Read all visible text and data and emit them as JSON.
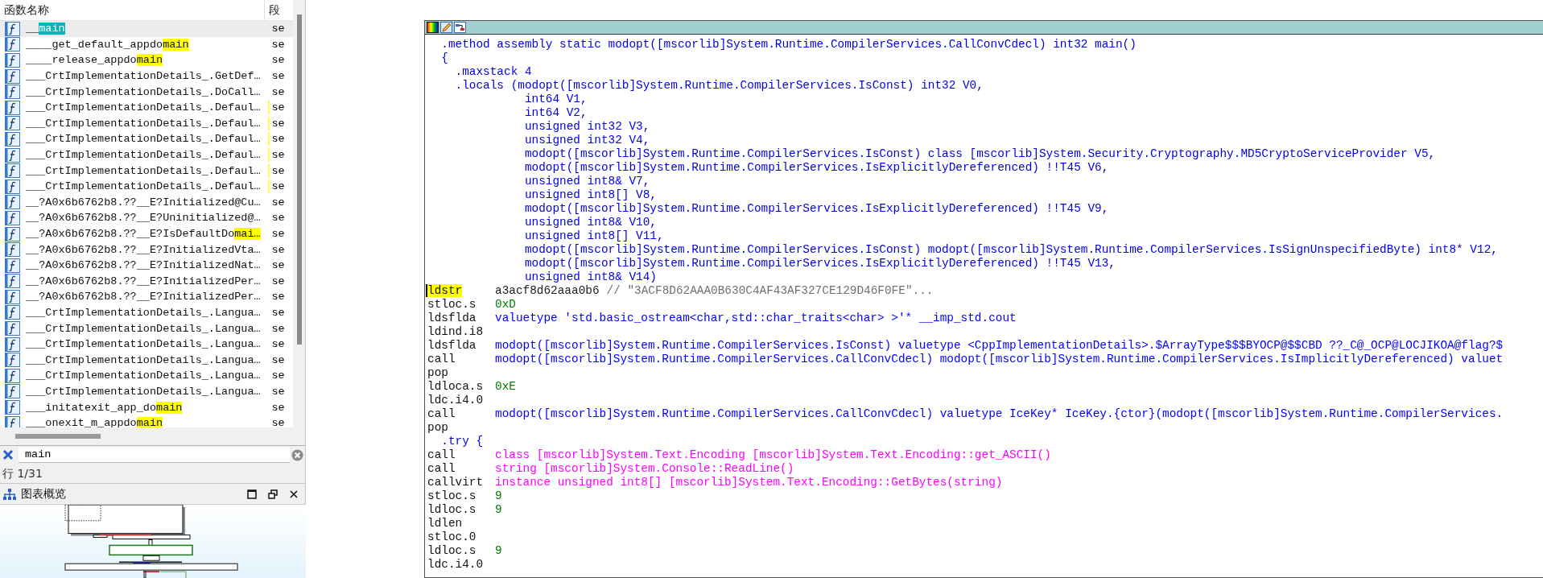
{
  "function_list": {
    "columns": [
      "函数名称",
      "段"
    ],
    "rows": [
      {
        "parts": [
          {
            "text": "__",
            "highlighted": false
          },
          {
            "text": "main",
            "highlighted": true
          }
        ],
        "segment": "se",
        "selected": true,
        "marked": false
      },
      {
        "parts": [
          {
            "text": "____get_default_appdo",
            "highlighted": false
          },
          {
            "text": "main",
            "highlighted": true
          }
        ],
        "segment": "se",
        "selected": false,
        "marked": false
      },
      {
        "parts": [
          {
            "text": "____release_appdo",
            "highlighted": false
          },
          {
            "text": "main",
            "highlighted": true
          }
        ],
        "segment": "se",
        "selected": false,
        "marked": false
      },
      {
        "parts": [
          {
            "text": "___CrtImplementationDetails_.GetDef…",
            "highlighted": false
          }
        ],
        "segment": "se",
        "selected": false,
        "marked": false
      },
      {
        "parts": [
          {
            "text": "___CrtImplementationDetails_.DoCall…",
            "highlighted": false
          }
        ],
        "segment": "se",
        "selected": false,
        "marked": false
      },
      {
        "parts": [
          {
            "text": "___CrtImplementationDetails_.Defaul…",
            "highlighted": false
          }
        ],
        "segment": "se",
        "selected": false,
        "marked": true
      },
      {
        "parts": [
          {
            "text": "___CrtImplementationDetails_.Defaul…",
            "highlighted": false
          }
        ],
        "segment": "se",
        "selected": false,
        "marked": true
      },
      {
        "parts": [
          {
            "text": "___CrtImplementationDetails_.Defaul…",
            "highlighted": false
          }
        ],
        "segment": "se",
        "selected": false,
        "marked": true
      },
      {
        "parts": [
          {
            "text": "___CrtImplementationDetails_.Defaul…",
            "highlighted": false
          }
        ],
        "segment": "se",
        "selected": false,
        "marked": true
      },
      {
        "parts": [
          {
            "text": "___CrtImplementationDetails_.Defaul…",
            "highlighted": false
          }
        ],
        "segment": "se",
        "selected": false,
        "marked": true
      },
      {
        "parts": [
          {
            "text": "___CrtImplementationDetails_.Defaul…",
            "highlighted": false
          }
        ],
        "segment": "se",
        "selected": false,
        "marked": true
      },
      {
        "parts": [
          {
            "text": "__?A0x6b6762b8.??__E?Initialized@Cu…",
            "highlighted": false
          }
        ],
        "segment": "se",
        "selected": false,
        "marked": false
      },
      {
        "parts": [
          {
            "text": "__?A0x6b6762b8.??__E?Uninitialized@…",
            "highlighted": false
          }
        ],
        "segment": "se",
        "selected": false,
        "marked": false
      },
      {
        "parts": [
          {
            "text": "__?A0x6b6762b8.??__E?IsDefaultDo",
            "highlighted": false
          },
          {
            "text": "mai…",
            "highlighted": true
          }
        ],
        "segment": "se",
        "selected": false,
        "marked": false
      },
      {
        "parts": [
          {
            "text": "__?A0x6b6762b8.??__E?InitializedVta…",
            "highlighted": false
          }
        ],
        "segment": "se",
        "selected": false,
        "marked": false
      },
      {
        "parts": [
          {
            "text": "__?A0x6b6762b8.??__E?InitializedNat…",
            "highlighted": false
          }
        ],
        "segment": "se",
        "selected": false,
        "marked": false
      },
      {
        "parts": [
          {
            "text": "__?A0x6b6762b8.??__E?InitializedPer…",
            "highlighted": false
          }
        ],
        "segment": "se",
        "selected": false,
        "marked": false
      },
      {
        "parts": [
          {
            "text": "__?A0x6b6762b8.??__E?InitializedPer…",
            "highlighted": false
          }
        ],
        "segment": "se",
        "selected": false,
        "marked": false
      },
      {
        "parts": [
          {
            "text": "___CrtImplementationDetails_.Langua…",
            "highlighted": false
          }
        ],
        "segment": "se",
        "selected": false,
        "marked": false
      },
      {
        "parts": [
          {
            "text": "___CrtImplementationDetails_.Langua…",
            "highlighted": false
          }
        ],
        "segment": "se",
        "selected": false,
        "marked": false
      },
      {
        "parts": [
          {
            "text": "___CrtImplementationDetails_.Langua…",
            "highlighted": false
          }
        ],
        "segment": "se",
        "selected": false,
        "marked": false
      },
      {
        "parts": [
          {
            "text": "___CrtImplementationDetails_.Langua…",
            "highlighted": false
          }
        ],
        "segment": "se",
        "selected": false,
        "marked": false
      },
      {
        "parts": [
          {
            "text": "___CrtImplementationDetails_.Langua…",
            "highlighted": false
          }
        ],
        "segment": "se",
        "selected": false,
        "marked": false
      },
      {
        "parts": [
          {
            "text": "___CrtImplementationDetails_.Langua…",
            "highlighted": false
          }
        ],
        "segment": "se",
        "selected": false,
        "marked": false
      },
      {
        "parts": [
          {
            "text": "___initatexit_app_do",
            "highlighted": false
          },
          {
            "text": "main",
            "highlighted": true
          }
        ],
        "segment": "se",
        "selected": false,
        "marked": false
      },
      {
        "parts": [
          {
            "text": "___onexit_m_appdo",
            "highlighted": false
          },
          {
            "text": "main",
            "highlighted": true
          }
        ],
        "segment": "se",
        "selected": false,
        "marked": false
      }
    ]
  },
  "search": {
    "value": "main"
  },
  "status": "行 1/31",
  "graph_overview": {
    "title": "图表概览"
  },
  "code": {
    "lines": [
      {
        "kind": "directive",
        "text": "  .method assembly static modopt([mscorlib]System.Runtime.CompilerServices.CallConvCdecl) int32 main()"
      },
      {
        "kind": "directive",
        "text": "  {"
      },
      {
        "kind": "directive",
        "text": "    .maxstack 4"
      },
      {
        "kind": "directive",
        "text": "    .locals (modopt([mscorlib]System.Runtime.CompilerServices.IsConst) int32 V0,"
      },
      {
        "kind": "directive",
        "text": "              int64 V1,"
      },
      {
        "kind": "directive",
        "text": "              int64 V2,"
      },
      {
        "kind": "directive",
        "text": "              unsigned int32 V3,"
      },
      {
        "kind": "directive",
        "text": "              unsigned int32 V4,"
      },
      {
        "kind": "directive",
        "text": "              modopt([mscorlib]System.Runtime.CompilerServices.IsConst) class [mscorlib]System.Security.Cryptography.MD5CryptoServiceProvider V5,"
      },
      {
        "kind": "directive",
        "text": "              modopt([mscorlib]System.Runtime.CompilerServices.IsExplicitlyDereferenced) !!T45 V6,"
      },
      {
        "kind": "directive",
        "text": "              unsigned int8& V7,"
      },
      {
        "kind": "directive",
        "text": "              unsigned int8[] V8,"
      },
      {
        "kind": "directive",
        "text": "              modopt([mscorlib]System.Runtime.CompilerServices.IsExplicitlyDereferenced) !!T45 V9,"
      },
      {
        "kind": "directive",
        "text": "              unsigned int8& V10,"
      },
      {
        "kind": "directive",
        "text": "              unsigned int8[] V11,"
      },
      {
        "kind": "directive",
        "text": "              modopt([mscorlib]System.Runtime.CompilerServices.IsConst) modopt([mscorlib]System.Runtime.CompilerServices.IsSignUnspecifiedByte) int8* V12,"
      },
      {
        "kind": "directive",
        "text": "              modopt([mscorlib]System.Runtime.CompilerServices.IsExplicitlyDereferenced) !!T45 V13,"
      },
      {
        "kind": "directive",
        "text": "              unsigned int8& V14)"
      },
      {
        "kind": "instruction",
        "opcode": "ldstr",
        "operand": "a3acf8d62aaa0b6",
        "color": "#202020",
        "comment": "// \"3ACF8D62AAA0B630C4AF43AF327CE129D46F0FE\"...",
        "highlighted": true
      },
      {
        "kind": "instruction",
        "opcode": "stloc.s",
        "operand": "0xD",
        "color": "#008000",
        "highlighted": false
      },
      {
        "kind": "instruction",
        "opcode": "ldsflda",
        "operand": "valuetype 'std.basic_ostream<char,std::char_traits<char> >'* __imp_std.cout",
        "color": "#0000ff",
        "highlighted": false
      },
      {
        "kind": "instruction",
        "opcode": "ldind.i8",
        "highlighted": false
      },
      {
        "kind": "instruction",
        "opcode": "ldsflda",
        "operand": "modopt([mscorlib]System.Runtime.CompilerServices.IsConst) valuetype <CppImplementationDetails>.$ArrayType$$$BYOCP@$$CBD ??_C@_OCP@LOCJIKOA@flag?$",
        "color": "#0000ff",
        "highlighted": false
      },
      {
        "kind": "instruction",
        "opcode": "call",
        "operand": "modopt([mscorlib]System.Runtime.CompilerServices.CallConvCdecl) modopt([mscorlib]System.Runtime.CompilerServices.IsImplicitlyDereferenced) valuet",
        "color": "#0000ff",
        "highlighted": false
      },
      {
        "kind": "instruction",
        "opcode": "pop",
        "highlighted": false
      },
      {
        "kind": "instruction",
        "opcode": "ldloca.s",
        "operand": "0xE",
        "color": "#008000",
        "highlighted": false
      },
      {
        "kind": "instruction",
        "opcode": "ldc.i4.0",
        "highlighted": false
      },
      {
        "kind": "instruction",
        "opcode": "call",
        "operand": "modopt([mscorlib]System.Runtime.CompilerServices.CallConvCdecl) valuetype IceKey* IceKey.{ctor}(modopt([mscorlib]System.Runtime.CompilerServices.",
        "color": "#0000ff",
        "highlighted": false
      },
      {
        "kind": "instruction",
        "opcode": "pop",
        "highlighted": false
      },
      {
        "kind": "directive",
        "text": "  .try {"
      },
      {
        "kind": "instruction",
        "opcode": "call",
        "operand": "class [mscorlib]System.Text.Encoding [mscorlib]System.Text.Encoding::get_ASCII()",
        "color": "#ff00ff",
        "highlighted": false
      },
      {
        "kind": "instruction",
        "opcode": "call",
        "operand": "string [mscorlib]System.Console::ReadLine()",
        "color": "#ff00ff",
        "highlighted": false
      },
      {
        "kind": "instruction",
        "opcode": "callvirt",
        "operand": "instance unsigned int8[] [mscorlib]System.Text.Encoding::GetBytes(string)",
        "color": "#ff00ff",
        "highlighted": false
      },
      {
        "kind": "instruction",
        "opcode": "stloc.s",
        "operand": "9",
        "color": "#008000",
        "highlighted": false
      },
      {
        "kind": "instruction",
        "opcode": "ldloc.s",
        "operand": "9",
        "color": "#008000",
        "highlighted": false
      },
      {
        "kind": "instruction",
        "opcode": "ldlen",
        "highlighted": false
      },
      {
        "kind": "instruction",
        "opcode": "stloc.0",
        "highlighted": false
      },
      {
        "kind": "instruction",
        "opcode": "ldloc.s",
        "operand": "9",
        "color": "#008000",
        "highlighted": false
      },
      {
        "kind": "instruction",
        "opcode": "ldc.i4.0",
        "highlighted": false
      }
    ]
  }
}
